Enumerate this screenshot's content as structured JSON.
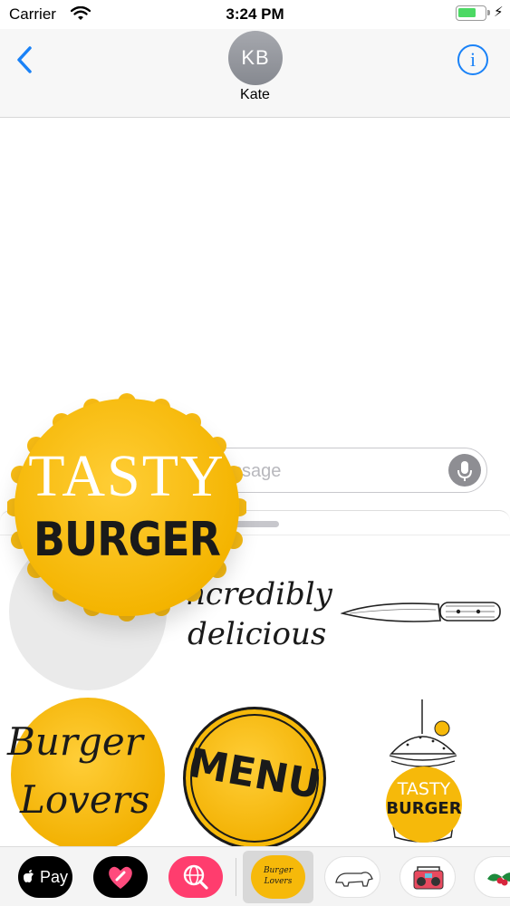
{
  "status_bar": {
    "carrier": "Carrier",
    "time": "3:24 PM",
    "battery_level": 0.7,
    "charging_symbol": "⚡"
  },
  "header": {
    "back_icon": "chevron-left-icon",
    "avatar_initials": "KB",
    "contact_name": "Kate",
    "info_icon": "info-icon",
    "info_symbol": "i",
    "accent_color": "#1a82f7"
  },
  "message_input": {
    "placeholder": "ssage",
    "mic_icon": "microphone-icon"
  },
  "stickers": {
    "dragged": {
      "line1": "TASTY",
      "line2": "BURGER",
      "color": "#f4b400"
    },
    "incredibly": {
      "line1": "ncredibly",
      "line2": "delicious"
    },
    "knife_icon": "knife-icon",
    "lovers": {
      "line1": "Burger",
      "line2": "Lovers"
    },
    "menu": {
      "label": "MENU"
    },
    "tower": {
      "line1": "TASTY",
      "line2": "BURGER"
    }
  },
  "app_drawer": {
    "apple_pay_label": "Pay",
    "apple_pay_icon": "apple-icon",
    "heart_app_icon": "heart-icon",
    "search_app_icon": "globe-search-icon",
    "burger_app": {
      "line1": "Burger",
      "line2": "Lovers"
    },
    "bear_app_icon": "bear-icon",
    "boombox_app_icon": "boombox-icon",
    "holly_app_icon": "holly-icon"
  }
}
